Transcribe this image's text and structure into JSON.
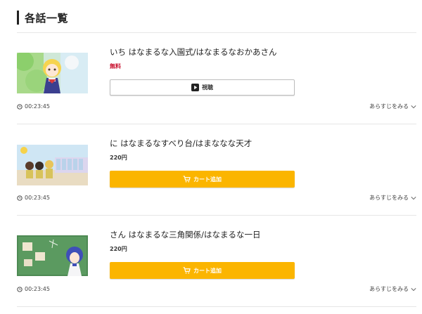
{
  "section": {
    "title": "各話一覧"
  },
  "episodes": [
    {
      "title": "いち はなまるな入園式/はなまるなおかあさん",
      "price": "無料",
      "button_label": "視聴",
      "duration": "00:23:45",
      "synopsis_label": "あらすじをみる"
    },
    {
      "title": "に はなまるなすべり台/はまななな天才",
      "price": "220円",
      "button_label": "カート追加",
      "duration": "00:23:45",
      "synopsis_label": "あらすじをみる"
    },
    {
      "title": "さん はなまるな三角関係/はなまるな一日",
      "price": "220円",
      "button_label": "カート追加",
      "duration": "00:23:45",
      "synopsis_label": "あらすじをみる"
    }
  ],
  "icons": {
    "clock": "clock-icon",
    "play": "play-icon",
    "cart": "cart-icon",
    "chevron": "chevron-down-icon"
  },
  "colors": {
    "cart_button": "#fbb500",
    "free_price": "#c8102e",
    "divider": "#e6e6e6"
  }
}
